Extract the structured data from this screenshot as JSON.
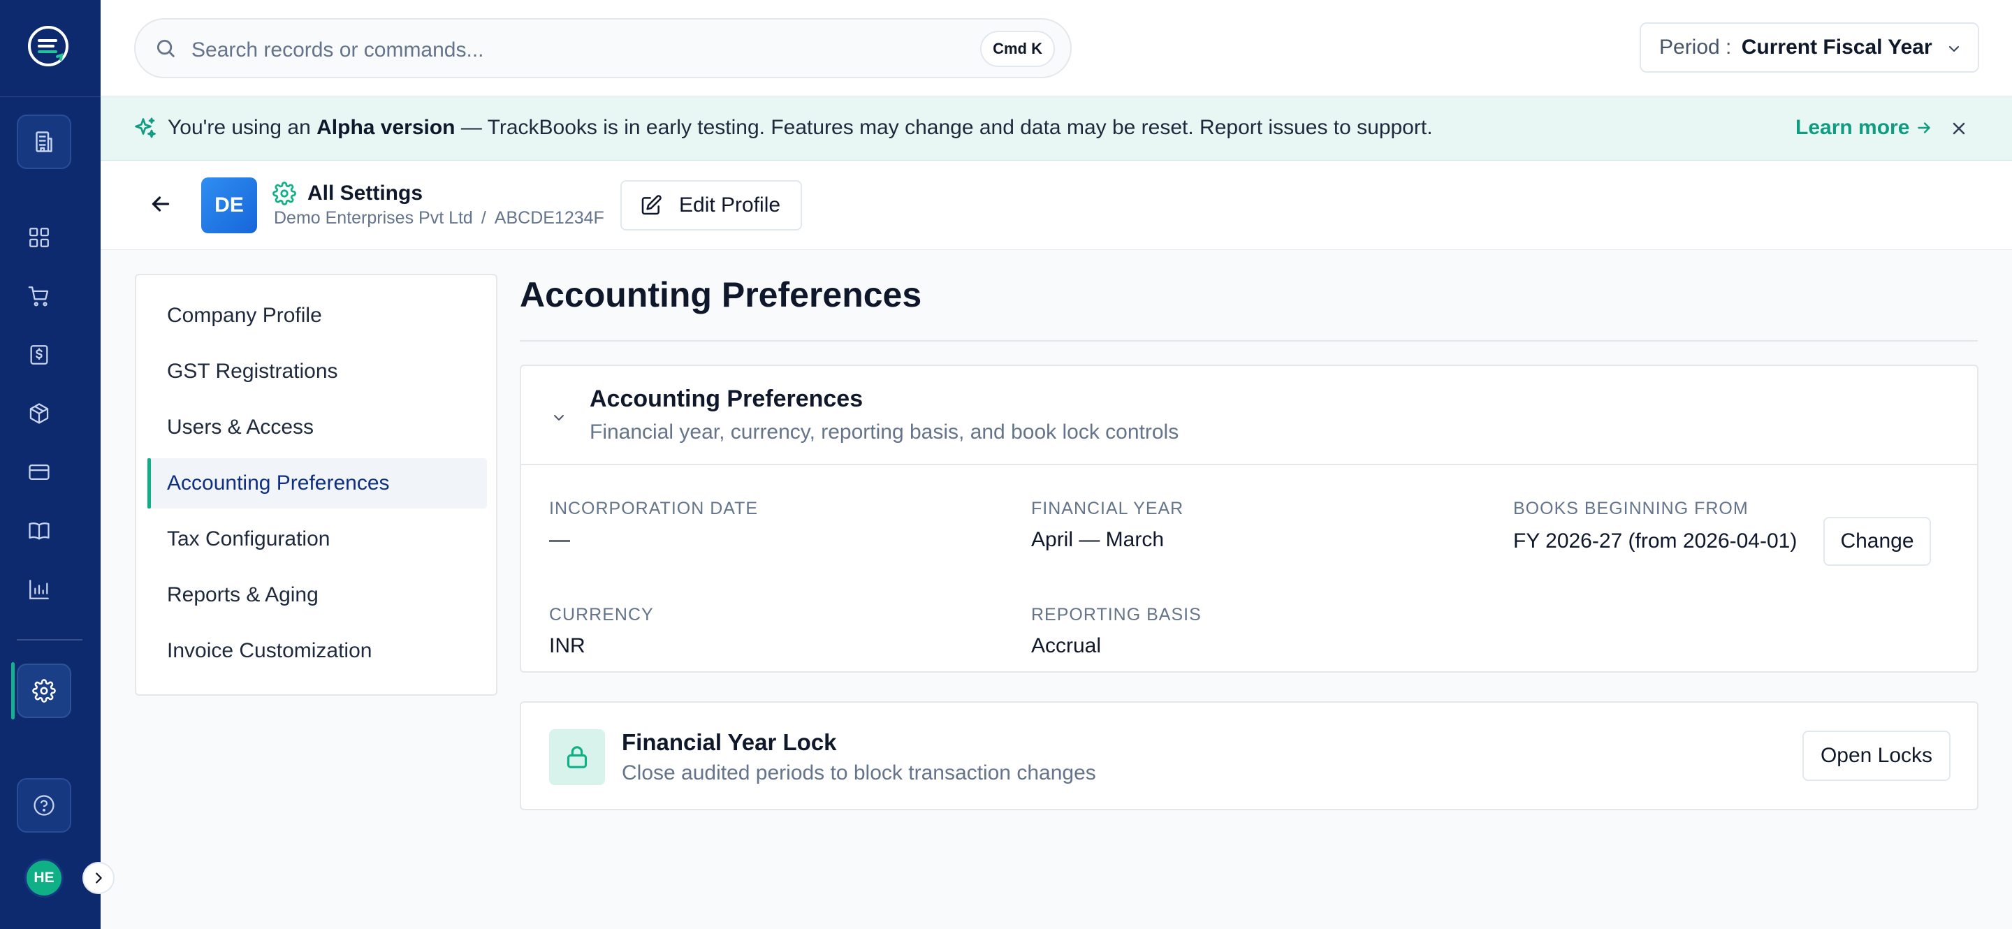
{
  "rail": {
    "avatar_initials": "HE"
  },
  "search": {
    "placeholder": "Search records or commands...",
    "shortcut": "Cmd K"
  },
  "period": {
    "label": "Period :",
    "value": "Current Fiscal Year"
  },
  "banner": {
    "prefix": "You're using an ",
    "highlight": "Alpha version",
    "message": " — TrackBooks is in early testing. Features may change and data may be reset. Report issues to support.",
    "learn_more": "Learn more"
  },
  "header": {
    "company_initials": "DE",
    "title": "All Settings",
    "company_name": "Demo Enterprises Pvt Ltd",
    "separator": "/",
    "company_id": "ABCDE1234F",
    "edit_button": "Edit Profile"
  },
  "settings_nav": {
    "items": [
      {
        "label": "Company Profile",
        "active": false
      },
      {
        "label": "GST Registrations",
        "active": false
      },
      {
        "label": "Users & Access",
        "active": false
      },
      {
        "label": "Accounting Preferences",
        "active": true
      },
      {
        "label": "Tax Configuration",
        "active": false
      },
      {
        "label": "Reports & Aging",
        "active": false
      },
      {
        "label": "Invoice Customization",
        "active": false
      }
    ]
  },
  "main": {
    "page_title": "Accounting Preferences",
    "prefs_card": {
      "title": "Accounting Preferences",
      "subtitle": "Financial year, currency, reporting basis, and book lock controls",
      "fields": {
        "incorporation_date": {
          "label": "INCORPORATION DATE",
          "value": "—"
        },
        "financial_year": {
          "label": "FINANCIAL YEAR",
          "value": "April — March"
        },
        "books_beginning": {
          "label": "BOOKS BEGINNING FROM",
          "value": "FY 2026-27 (from 2026-04-01)"
        },
        "currency": {
          "label": "CURRENCY",
          "value": "INR"
        },
        "reporting_basis": {
          "label": "REPORTING BASIS",
          "value": "Accrual"
        }
      },
      "change_button": "Change"
    },
    "lock_card": {
      "title": "Financial Year Lock",
      "subtitle": "Close audited periods to block transaction changes",
      "button": "Open Locks"
    }
  },
  "colors": {
    "rail_bg": "#0d2a6e",
    "accent_teal": "#10b087",
    "link_teal": "#0f9c80",
    "banner_bg": "#e8f7f4",
    "avatar_blue": "#1f7ae6"
  }
}
